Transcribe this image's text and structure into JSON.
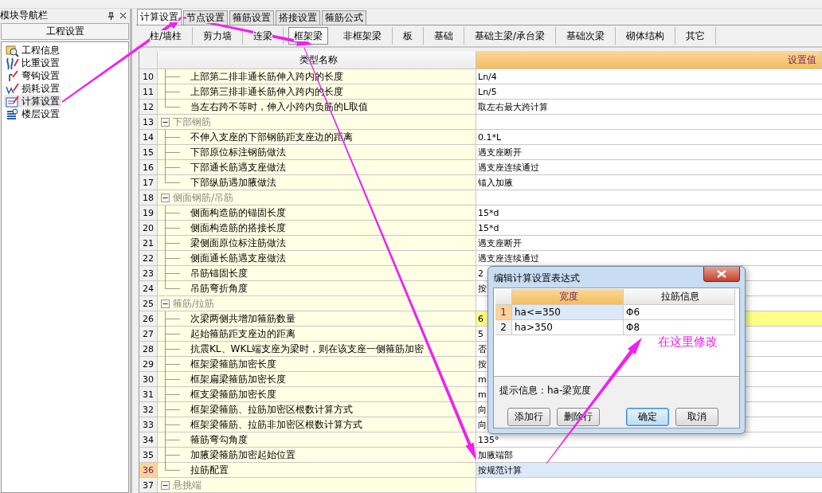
{
  "nav_panel": {
    "title": "模块导航栏",
    "section": "工程设置",
    "items": [
      {
        "label": "工程信息",
        "selected": false
      },
      {
        "label": "比重设置",
        "selected": false
      },
      {
        "label": "弯钩设置",
        "selected": false
      },
      {
        "label": "损耗设置",
        "selected": false
      },
      {
        "label": "计算设置",
        "selected": true
      },
      {
        "label": "楼层设置",
        "selected": false
      }
    ]
  },
  "tabs": [
    {
      "label": "计算设置",
      "selected": true
    },
    {
      "label": "节点设置",
      "selected": false
    },
    {
      "label": "箍筋设置",
      "selected": false
    },
    {
      "label": "搭接设置",
      "selected": false
    },
    {
      "label": "箍筋公式",
      "selected": false
    }
  ],
  "subtabs": [
    {
      "label": "柱/墙柱",
      "selected": false
    },
    {
      "label": "剪力墙",
      "selected": false
    },
    {
      "label": "连梁",
      "selected": false
    },
    {
      "label": "框架梁",
      "selected": true
    },
    {
      "label": "非框架梁",
      "selected": false
    },
    {
      "label": "板",
      "selected": false
    },
    {
      "label": "基础",
      "selected": false
    },
    {
      "label": "基础主梁/承台梁",
      "selected": false
    },
    {
      "label": "基础次梁",
      "selected": false
    },
    {
      "label": "砌体结构",
      "selected": false
    },
    {
      "label": "其它",
      "selected": false
    }
  ],
  "table": {
    "columns": [
      "类型名称",
      "设置值"
    ],
    "rows": [
      {
        "number": "10",
        "kind": "item",
        "name": "上部第二排非通长筋伸入跨内的长度",
        "value": "Ln/4",
        "selected": false,
        "highlighted": false
      },
      {
        "number": "11",
        "kind": "item",
        "name": "上部第三排非通长筋伸入跨内的长度",
        "value": "Ln/5",
        "selected": false,
        "highlighted": false
      },
      {
        "number": "12",
        "kind": "item",
        "name": "当左右跨不等时，伸入小跨内负筋的L取值",
        "value": "取左右最大跨计算",
        "selected": false,
        "highlighted": false
      },
      {
        "number": "13",
        "kind": "group",
        "name": "下部钢筋",
        "expanded": true,
        "selected": false,
        "highlighted": false
      },
      {
        "number": "14",
        "kind": "item",
        "name": "不伸入支座的下部钢筋距支座边的距离",
        "value": "0.1*L",
        "selected": false,
        "highlighted": false
      },
      {
        "number": "15",
        "kind": "item",
        "name": "下部原位标注钢筋做法",
        "value": "遇支座断开",
        "selected": false,
        "highlighted": false
      },
      {
        "number": "16",
        "kind": "item",
        "name": "下部通长筋遇支座做法",
        "value": "遇支座连续通过",
        "selected": false,
        "highlighted": false
      },
      {
        "number": "17",
        "kind": "item",
        "name": "下部纵筋遇加腋做法",
        "value": "锚入加腋",
        "selected": false,
        "highlighted": false
      },
      {
        "number": "18",
        "kind": "group",
        "name": "侧面钢筋/吊筋",
        "expanded": true,
        "selected": false,
        "highlighted": false
      },
      {
        "number": "19",
        "kind": "item",
        "name": "侧面构造筋的锚固长度",
        "value": "15*d",
        "selected": false,
        "highlighted": false
      },
      {
        "number": "20",
        "kind": "item",
        "name": "侧面构造筋的搭接长度",
        "value": "15*d",
        "selected": false,
        "highlighted": false
      },
      {
        "number": "21",
        "kind": "item",
        "name": "梁侧面原位标注筋做法",
        "value": "遇支座断开",
        "selected": false,
        "highlighted": false
      },
      {
        "number": "22",
        "kind": "item",
        "name": "侧面通长筋遇支座做法",
        "value": "遇支座连续通过",
        "selected": false,
        "highlighted": false
      },
      {
        "number": "23",
        "kind": "item",
        "name": "吊筋锚固长度",
        "value": "2",
        "selected": false,
        "highlighted": false
      },
      {
        "number": "24",
        "kind": "item",
        "name": "吊筋弯折角度",
        "value": "按",
        "selected": false,
        "highlighted": false
      },
      {
        "number": "25",
        "kind": "group",
        "name": "箍筋/拉筋",
        "expanded": true,
        "selected": false,
        "highlighted": false
      },
      {
        "number": "26",
        "kind": "item",
        "name": "次梁两侧共增加箍筋数量",
        "value": "6",
        "selected": false,
        "highlighted": true
      },
      {
        "number": "27",
        "kind": "item",
        "name": "起始箍筋距支座边的距离",
        "value": "5",
        "selected": false,
        "highlighted": false
      },
      {
        "number": "28",
        "kind": "item",
        "name": "抗震KL、WKL端支座为梁时，则在该支座一侧箍筋加密",
        "value": "否",
        "selected": false,
        "highlighted": false
      },
      {
        "number": "29",
        "kind": "item",
        "name": "框架梁箍筋加密长度",
        "value": "按",
        "selected": false,
        "highlighted": false
      },
      {
        "number": "30",
        "kind": "item",
        "name": "框架扁梁箍筋加密长度",
        "value": "m",
        "selected": false,
        "highlighted": false
      },
      {
        "number": "31",
        "kind": "item",
        "name": "框支梁箍筋加密长度",
        "value": "m",
        "selected": false,
        "highlighted": false
      },
      {
        "number": "32",
        "kind": "item",
        "name": "框架梁箍筋、拉筋加密区根数计算方式",
        "value": "向",
        "selected": false,
        "highlighted": false
      },
      {
        "number": "33",
        "kind": "item",
        "name": "框架梁箍筋、拉筋非加密区根数计算方式",
        "value": "向",
        "selected": false,
        "highlighted": false
      },
      {
        "number": "34",
        "kind": "item",
        "name": "箍筋弯勾角度",
        "value": "135°",
        "selected": false,
        "highlighted": false
      },
      {
        "number": "35",
        "kind": "item",
        "name": "加腋梁箍筋加密起始位置",
        "value": "加腋端部",
        "selected": false,
        "highlighted": false
      },
      {
        "number": "36",
        "kind": "item",
        "name": "拉筋配置",
        "value": "按规范计算",
        "selected": true,
        "highlighted": false
      },
      {
        "number": "37",
        "kind": "group",
        "name": "悬挑端",
        "expanded": true,
        "selected": false,
        "highlighted": false
      }
    ]
  },
  "dialog": {
    "title": "编辑计算设置表达式",
    "columns": [
      {
        "label": "宽度",
        "selected": true
      },
      {
        "label": "拉筋信息",
        "selected": false
      }
    ],
    "rows": [
      {
        "number": "1",
        "width": "ha<=350",
        "rebar": "Φ6",
        "selected": true
      },
      {
        "number": "2",
        "width": "ha>350",
        "rebar": "Φ8",
        "selected": false
      }
    ],
    "hint": "提示信息：ha-梁宽度",
    "buttons": [
      {
        "label": "添加行",
        "focused": false
      },
      {
        "label": "删除行",
        "focused": false
      },
      {
        "label": "确定",
        "focused": true
      },
      {
        "label": "取消",
        "focused": false
      }
    ]
  },
  "annotation": {
    "note": "在这里修改"
  }
}
